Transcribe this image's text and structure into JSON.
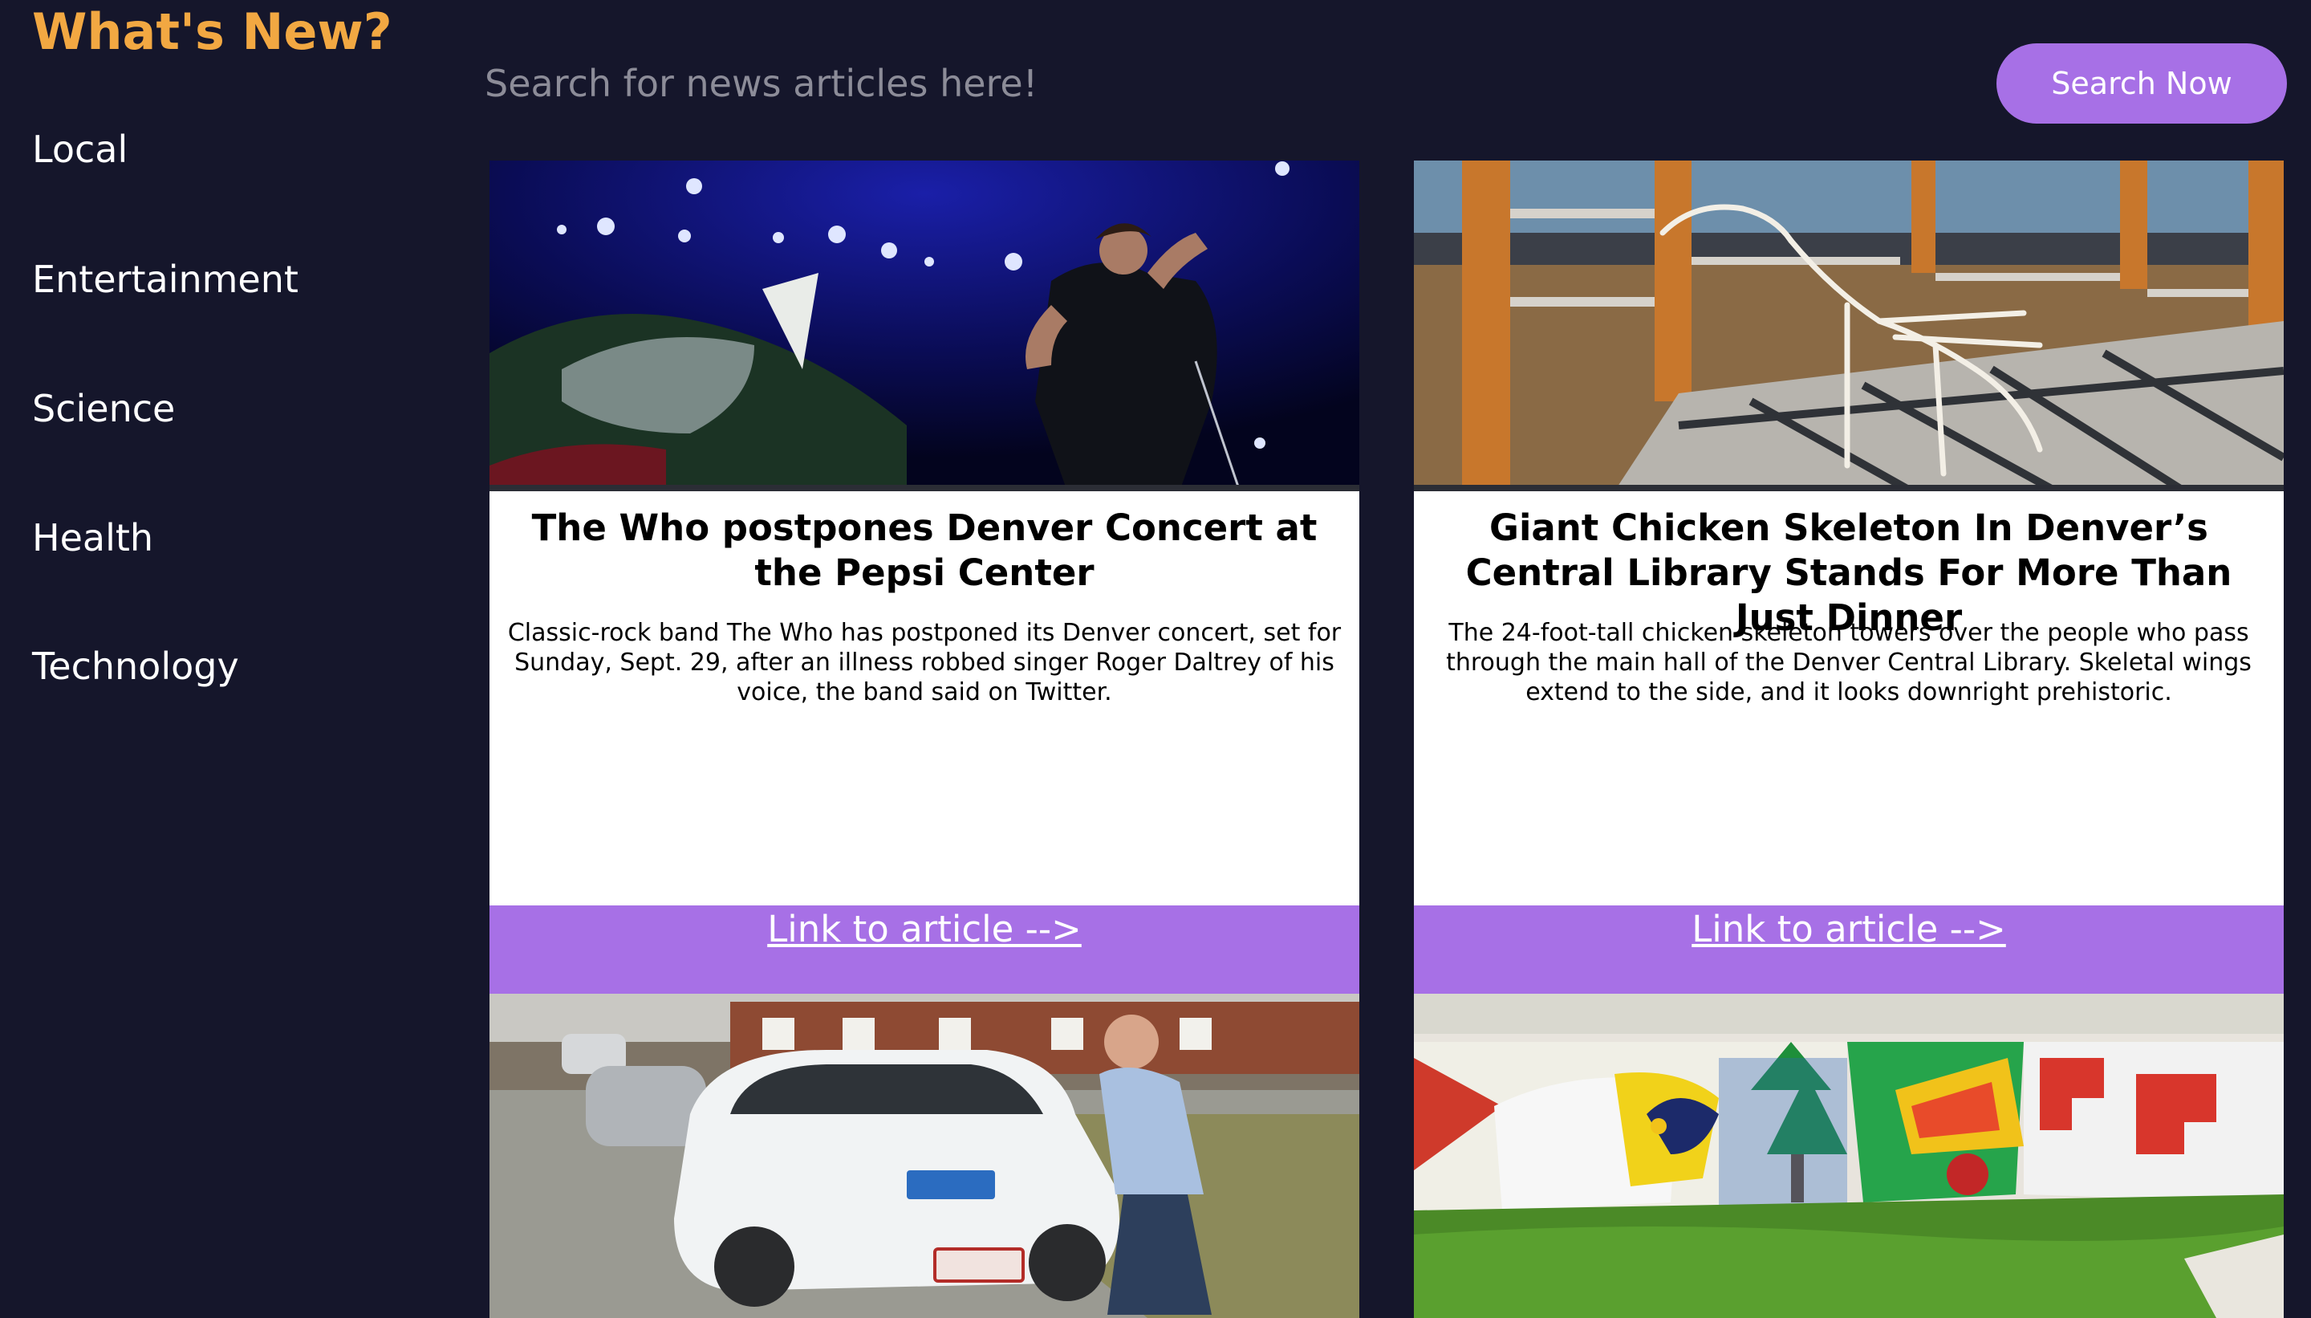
{
  "header": {
    "brand": "What's New?",
    "search_placeholder": "Search for news articles here!",
    "search_button": "Search Now"
  },
  "sidebar": {
    "items": [
      {
        "label": "Local"
      },
      {
        "label": "Entertainment"
      },
      {
        "label": "Science"
      },
      {
        "label": "Health"
      },
      {
        "label": "Technology"
      }
    ]
  },
  "articles": [
    {
      "title": "The Who postpones Denver Concert at the Pepsi Center",
      "description": "Classic-rock band The Who has postponed its Denver concert, set for Sunday, Sept. 29, after an illness robbed singer Roger Daltrey of his voice, the band said on Twitter.",
      "link_text": "Link to article -->"
    },
    {
      "title": "Giant Chicken Skeleton In Denver’s Central Library Stands For More Than Just Dinner",
      "description": "The 24-foot-tall chicken skeleton towers over the people who pass through the main hall of the Denver Central Library. Skeletal wings extend to the side, and it looks downright prehistoric.",
      "link_text": "Link to article -->"
    }
  ],
  "colors": {
    "background": "#15162b",
    "brand": "#f2a842",
    "accent": "#a770e6",
    "card": "#ffffff"
  }
}
